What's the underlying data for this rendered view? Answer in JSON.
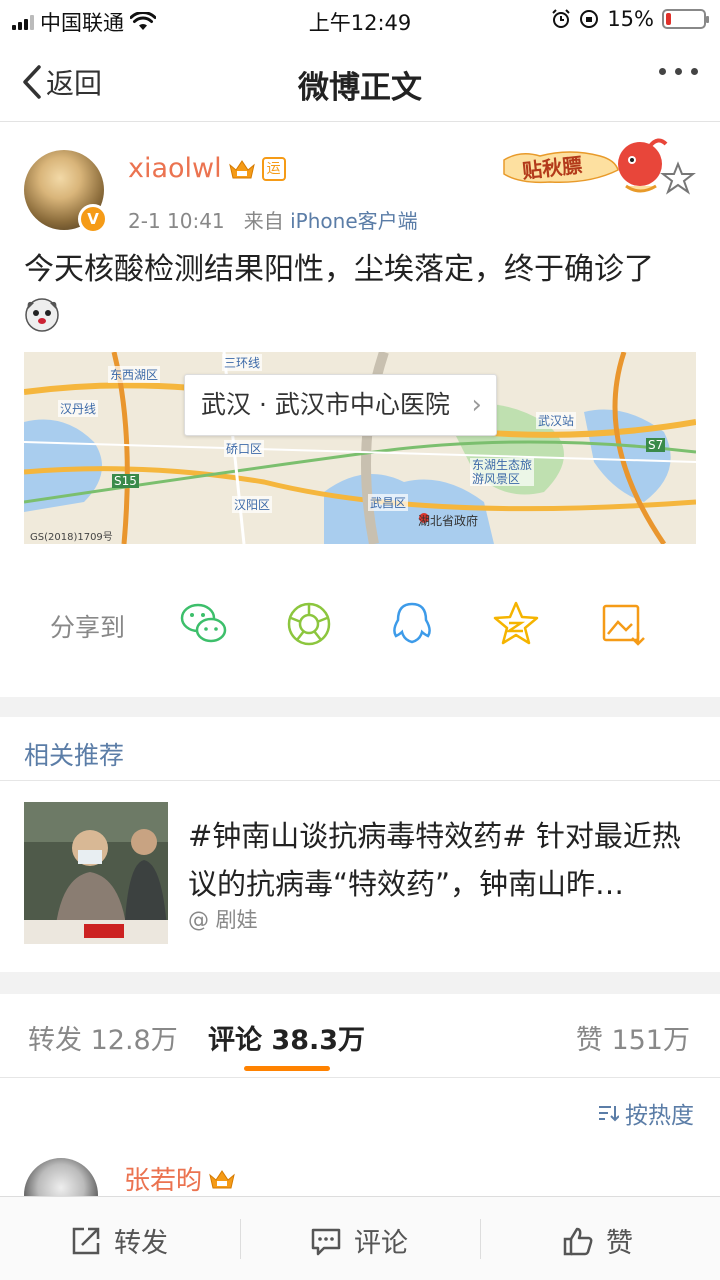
{
  "status_bar": {
    "carrier": "中国联通",
    "time": "上午12:49",
    "battery_text": "15%",
    "battery_level": 0.15
  },
  "nav": {
    "back_label": "返回",
    "title": "微博正文"
  },
  "post": {
    "username": "xiaolwl",
    "badge_text": "运",
    "avatar_badge": "V",
    "time": "2-1 10:41",
    "source_prefix": "来自",
    "source": "iPhone客户端",
    "text": "今天核酸检测结果阳性，尘埃落定，终于确诊了",
    "sticker_text": "贴秋膘",
    "location": "武汉 · 武汉市中心医院",
    "map_labels": {
      "l1": "东西湖区",
      "l2": "三环线",
      "l3": "汉丹线",
      "l4": "硚口区",
      "l5": "汉阳区",
      "l6": "武昌区",
      "l7": "东湖生态旅游风景区",
      "l8": "武汉站",
      "l9": "S15",
      "l10": "S7",
      "l11": "GS(2018)1709号",
      "pin": "湖北省政府"
    }
  },
  "share": {
    "label": "分享到",
    "icons": [
      "wechat-icon",
      "moments-icon",
      "qq-icon",
      "qzone-icon",
      "save-image-icon"
    ]
  },
  "related": {
    "heading": "相关推荐",
    "title": "#钟南山谈抗病毒特效药# 针对最近热议的抗病毒“特效药”，钟南山昨…",
    "author": "@ 剧娃"
  },
  "tabs": {
    "repost_label": "转发",
    "repost_count": "12.8万",
    "comment_label": "评论",
    "comment_count": "38.3万",
    "like_label": "赞",
    "like_count": "151万"
  },
  "sort_label": "按热度",
  "comment": {
    "username": "张若昀"
  },
  "bottom_bar": {
    "repost": "转发",
    "comment": "评论",
    "like": "赞"
  },
  "colors": {
    "accent_orange": "#ff8200",
    "username": "#eb7350",
    "link_blue": "#5b7da7"
  }
}
